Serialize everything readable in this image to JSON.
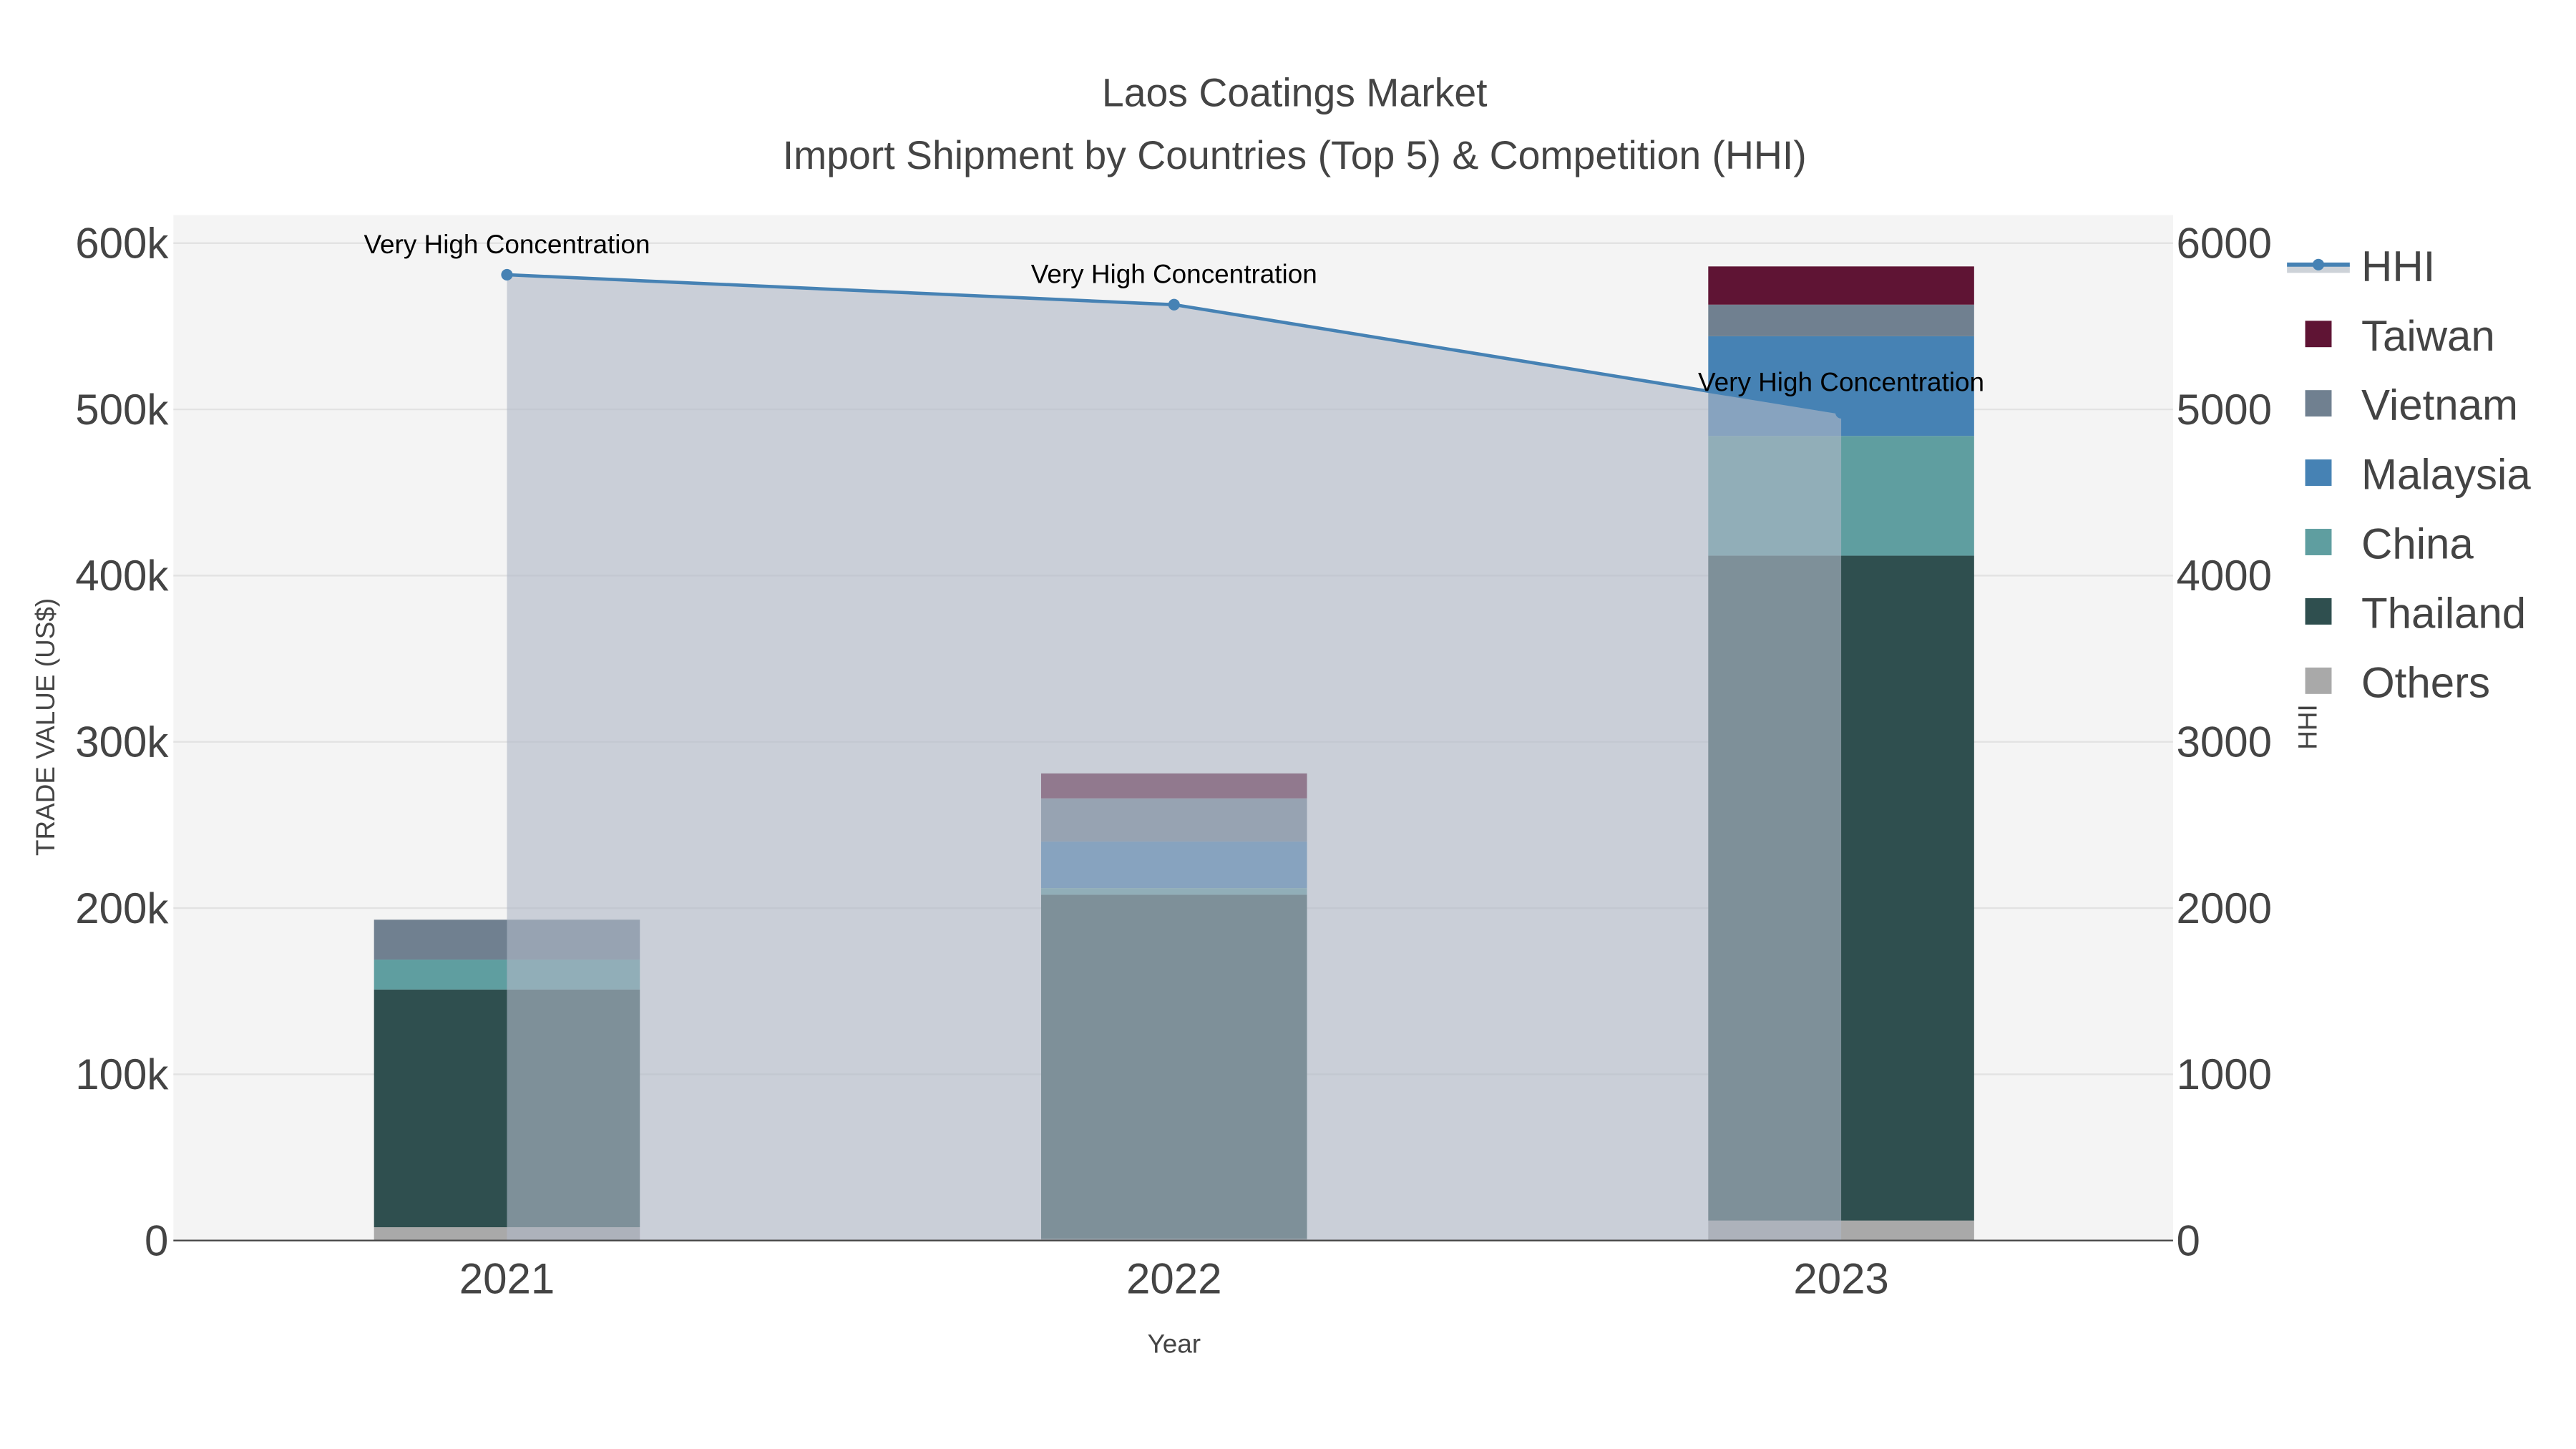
{
  "chart_data": {
    "type": "bar",
    "title": "Laos Coatings Market",
    "subtitle": "Import Shipment by Countries (Top 5) & Competition (HHI)",
    "xlabel": "Year",
    "ylabel": "TRADE VALUE (US$)",
    "y2label": "HHI",
    "categories": [
      "2021",
      "2022",
      "2023"
    ],
    "ylim": [
      0,
      600000
    ],
    "y2lim": [
      0,
      6000
    ],
    "yticks": [
      "0",
      "100k",
      "200k",
      "300k",
      "400k",
      "500k",
      "600k"
    ],
    "y2ticks": [
      "0",
      "1000",
      "2000",
      "3000",
      "4000",
      "5000",
      "6000"
    ],
    "grid": true,
    "legend_placement": "right",
    "stacked": true,
    "series": [
      {
        "name": "Others",
        "color": "#a9a9a9",
        "values": [
          8000,
          1000,
          12000
        ]
      },
      {
        "name": "Thailand",
        "color": "#2f4f4f",
        "values": [
          143000,
          207000,
          400000
        ]
      },
      {
        "name": "China",
        "color": "#5f9ea0",
        "values": [
          18000,
          4000,
          72000
        ]
      },
      {
        "name": "Malaysia",
        "color": "#4682b4",
        "values": [
          0,
          28000,
          60000
        ]
      },
      {
        "name": "Vietnam",
        "color": "#708090",
        "values": [
          24000,
          26000,
          19000
        ]
      },
      {
        "name": "Taiwan",
        "color": "#5f1434",
        "values": [
          0,
          15000,
          23000
        ]
      }
    ],
    "hhi": {
      "name": "HHI",
      "color": "#4682b4",
      "values": [
        5810,
        5630,
        4980
      ],
      "annotations": [
        "Very High Concentration",
        "Very High Concentration",
        "Very High Concentration"
      ]
    },
    "legend": [
      "HHI",
      "Taiwan",
      "Vietnam",
      "Malaysia",
      "China",
      "Thailand",
      "Others"
    ]
  }
}
